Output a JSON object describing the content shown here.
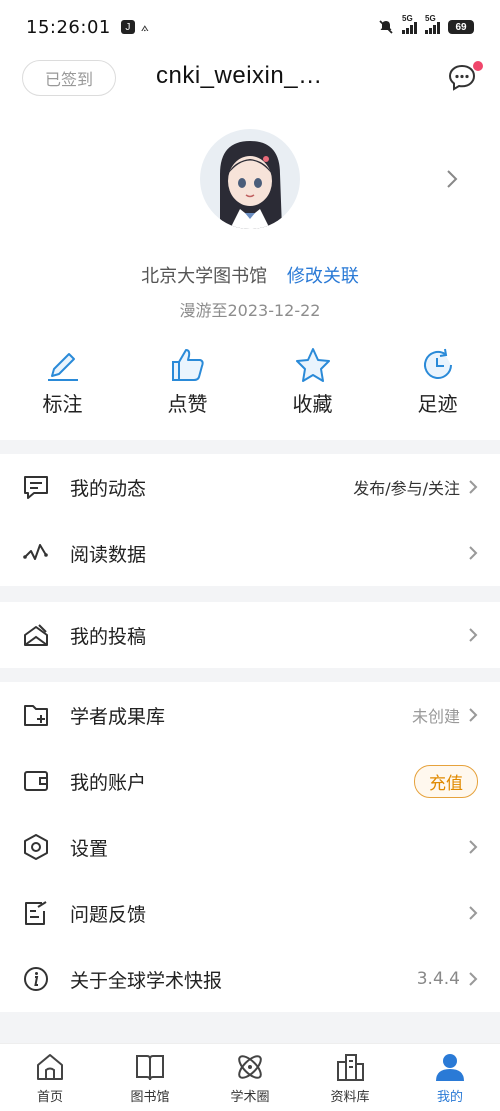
{
  "status_bar": {
    "time": "15:26:01",
    "left_icons": [
      "J",
      "signal-a-icon"
    ],
    "network1": "5G",
    "network2": "5G",
    "battery": "69"
  },
  "header": {
    "checkin_label": "已签到",
    "username": "cnki_weixin_…",
    "org_name": "北京大学图书馆",
    "org_link": "修改关联",
    "roam_text": "漫游至2023-12-22"
  },
  "quick_actions": [
    {
      "label": "标注",
      "icon": "pencil-icon"
    },
    {
      "label": "点赞",
      "icon": "thumbs-up-icon"
    },
    {
      "label": "收藏",
      "icon": "star-icon"
    },
    {
      "label": "足迹",
      "icon": "clock-history-icon"
    }
  ],
  "menu": {
    "dynamics": {
      "label": "我的动态",
      "sub": "发布/参与/关注"
    },
    "reading": {
      "label": "阅读数据"
    },
    "submission": {
      "label": "我的投稿"
    },
    "scholar": {
      "label": "学者成果库",
      "sub": "未创建"
    },
    "account": {
      "label": "我的账户",
      "action": "充值"
    },
    "settings": {
      "label": "设置"
    },
    "feedback": {
      "label": "问题反馈"
    },
    "about": {
      "label": "关于全球学术快报",
      "sub": "3.4.4"
    }
  },
  "tabs": [
    {
      "label": "首页",
      "icon": "home-icon"
    },
    {
      "label": "图书馆",
      "icon": "book-icon"
    },
    {
      "label": "学术圈",
      "icon": "atom-icon"
    },
    {
      "label": "资料库",
      "icon": "buildings-icon"
    },
    {
      "label": "我的",
      "icon": "user-icon"
    }
  ],
  "colors": {
    "accent": "#2a7ad6",
    "badge": "#f0466b",
    "recharge": "#e08a00",
    "background": "#f3f4f6"
  }
}
